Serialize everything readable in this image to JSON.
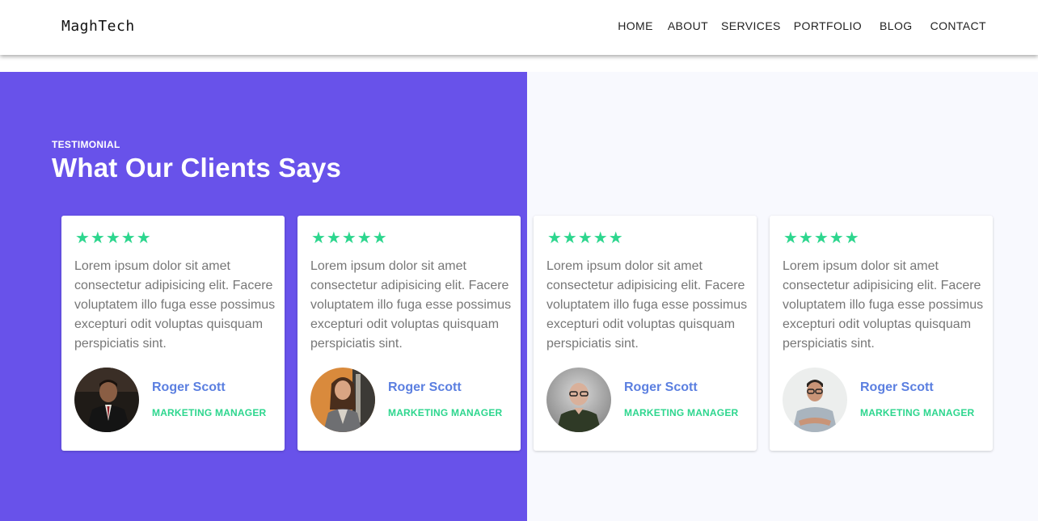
{
  "header": {
    "logo": "MaghTech",
    "nav": [
      "HOME",
      "ABOUT",
      "SERVICES",
      "PORTFOLIO",
      "BLOG",
      "CONTACT"
    ]
  },
  "section": {
    "eyebrow": "TESTIMONIAL",
    "title": "What Our Clients Says"
  },
  "colors": {
    "accent_purple": "#6852ea",
    "star_green": "#2dd68e",
    "name_blue": "#5b7fe0"
  },
  "testimonials": [
    {
      "rating": 5,
      "stars": "★★★★★",
      "quote": "Lorem ipsum dolor sit amet consectetur adipisicing elit. Facere voluptatem illo fuga esse possimus excepturi odit voluptas quisquam perspiciatis sint.",
      "name": "Roger Scott",
      "role": "MARKETING MANAGER",
      "avatar": "avatar-man-suit"
    },
    {
      "rating": 5,
      "stars": "★★★★★",
      "quote": "Lorem ipsum dolor sit amet consectetur adipisicing elit. Facere voluptatem illo fuga esse possimus excepturi odit voluptas quisquam perspiciatis sint.",
      "name": "Roger Scott",
      "role": "MARKETING MANAGER",
      "avatar": "avatar-woman-blazer"
    },
    {
      "rating": 5,
      "stars": "★★★★★",
      "quote": "Lorem ipsum dolor sit amet consectetur adipisicing elit. Facere voluptatem illo fuga esse possimus excepturi odit voluptas quisquam perspiciatis sint.",
      "name": "Roger Scott",
      "role": "MARKETING MANAGER",
      "avatar": "avatar-bald-man-glasses"
    },
    {
      "rating": 5,
      "stars": "★★★★★",
      "quote": "Lorem ipsum dolor sit amet consectetur adipisicing elit. Facere voluptatem illo fuga esse possimus excepturi odit voluptas quisquam perspiciatis sint.",
      "name": "Roger Scott",
      "role": "MARKETING MANAGER",
      "avatar": "avatar-man-arms-crossed"
    }
  ]
}
